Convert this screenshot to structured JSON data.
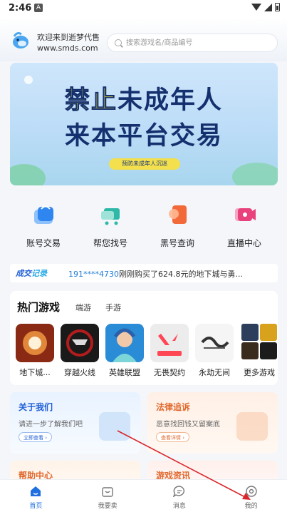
{
  "status_bar": {
    "time": "2:46",
    "notif": "A"
  },
  "header": {
    "welcome": "欢迎来到逝梦代售",
    "site": "www.smds.com",
    "search_placeholder": "搜索游戏名/商品编号"
  },
  "banner": {
    "line1_highlight": "禁止",
    "line1_rest": "未成年人",
    "line2": "来本平台交易",
    "pill": "预防未成年人沉迷"
  },
  "quick_actions": [
    {
      "label": "账号交易",
      "icon": "bag-icon",
      "color": "#2f86f0"
    },
    {
      "label": "帮您找号",
      "icon": "cart-icon",
      "color": "#2fb8a8"
    },
    {
      "label": "黑号查询",
      "icon": "search-doc-icon",
      "color": "#f26a3a"
    },
    {
      "label": "直播中心",
      "icon": "video-icon",
      "color": "#e8417b"
    }
  ],
  "ticker": {
    "badge_a": "成交",
    "badge_b": "记录",
    "phone": "191****4730",
    "message": "刚刚购买了624.8元的地下城与勇..."
  },
  "hot_games": {
    "title": "热门游戏",
    "tabs": [
      "端游",
      "手游"
    ],
    "games": [
      {
        "name": "地下城...",
        "color1": "#8a2a14",
        "color2": "#e0873a"
      },
      {
        "name": "穿越火线",
        "color1": "#1a1a1a",
        "color2": "#b31c1c"
      },
      {
        "name": "英雄联盟",
        "color1": "#2a8bd6",
        "color2": "#7cd6d8"
      },
      {
        "name": "无畏契约",
        "color1": "#ececec",
        "color2": "#ff4655"
      },
      {
        "name": "永劫无间",
        "color1": "#f5f5f5",
        "color2": "#333333"
      }
    ],
    "more_label": "更多游戏"
  },
  "promos": {
    "about": {
      "title": "关于我们",
      "subtitle": "请进一步了解我们吧",
      "button": "立即查看 ›"
    },
    "legal": {
      "title": "法律追诉",
      "subtitle": "恶意找回钱又留案底",
      "button": "查看详情 ›"
    },
    "help": {
      "title": "帮助中心"
    },
    "news": {
      "title": "游戏资讯"
    }
  },
  "tabbar": [
    {
      "label": "首页",
      "icon": "home-icon",
      "active": true
    },
    {
      "label": "我要卖",
      "icon": "sell-bag-icon",
      "active": false
    },
    {
      "label": "消息",
      "icon": "message-icon",
      "active": false
    },
    {
      "label": "我的",
      "icon": "profile-icon",
      "active": false
    }
  ],
  "colors": {
    "accent": "#1f6fe0",
    "warm": "#e0672c",
    "annotation": "#d9262c"
  }
}
